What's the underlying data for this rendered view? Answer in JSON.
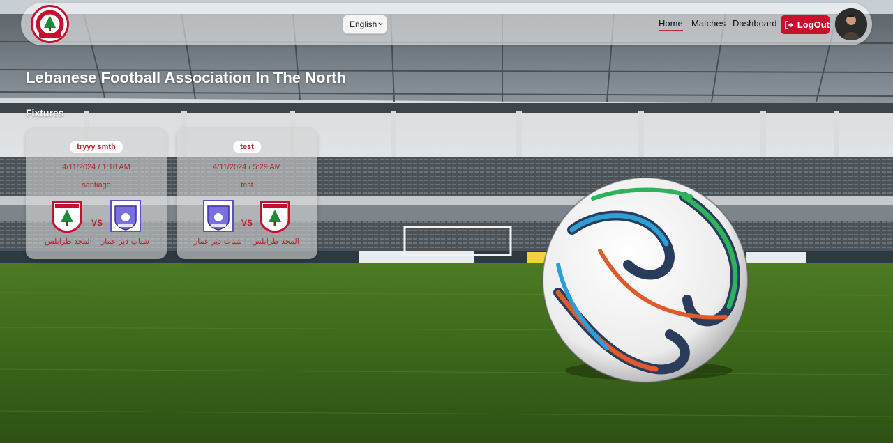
{
  "app": {
    "logo_alt": "LEBANON F.A"
  },
  "navbar": {
    "language": "English",
    "links": [
      {
        "label": "Home",
        "active": true
      },
      {
        "label": "Matches",
        "active": false
      },
      {
        "label": "Dashboard",
        "active": false
      }
    ],
    "logout_label": "LogOut"
  },
  "page": {
    "title": "Lebanese Football Association In The North",
    "section": "Fixtures"
  },
  "fixtures": [
    {
      "name": "tryyy smth",
      "datetime": "4/11/2024 / 1:18 AM",
      "venue": "santiago",
      "vs": "VS",
      "home_team": "المجد طرابلس",
      "away_team": "شباب دير عمار"
    },
    {
      "name": "test",
      "datetime": "4/11/2024 / 5:29 AM",
      "venue": "test",
      "vs": "VS",
      "home_team": "شباب دير عمار",
      "away_team": "المجد طرابلس"
    }
  ],
  "colors": {
    "accent_red": "#c8102e",
    "text_red": "#b3242c"
  },
  "icons": {
    "logout": "logout-icon",
    "caret": "chevron-down-icon"
  }
}
